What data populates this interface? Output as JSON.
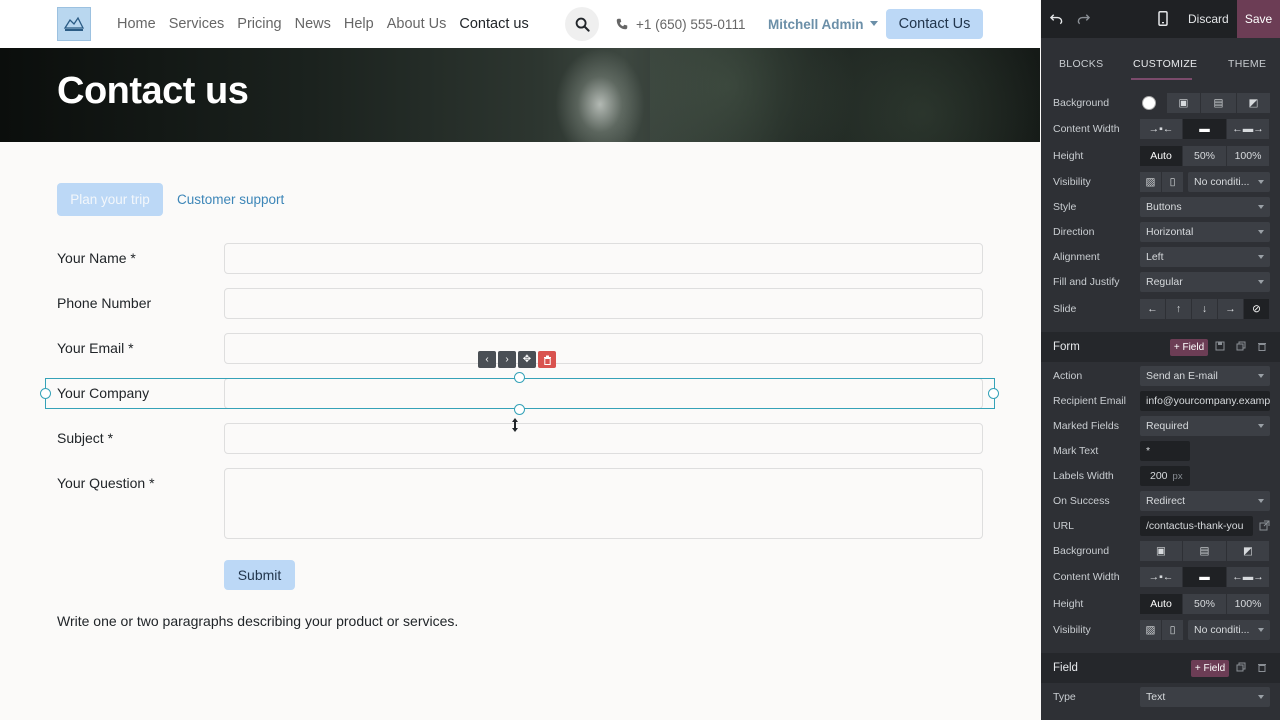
{
  "navbar": {
    "links": [
      "Home",
      "Services",
      "Pricing",
      "News",
      "Help",
      "About Us",
      "Contact us"
    ],
    "active_index": 6,
    "phone": "+1 (650) 555-0111",
    "user": "Mitchell Admin",
    "cta": "Contact Us"
  },
  "hero": {
    "title": "Contact us"
  },
  "tabs": {
    "active": "Plan your trip",
    "other": "Customer support"
  },
  "form": {
    "fields": [
      {
        "label": "Your Name",
        "required": true
      },
      {
        "label": "Phone Number",
        "required": false
      },
      {
        "label": "Your Email",
        "required": true
      },
      {
        "label": "Your Company",
        "required": false
      },
      {
        "label": "Subject",
        "required": true
      },
      {
        "label": "Your Question",
        "required": true
      }
    ],
    "mark": "*",
    "submit": "Submit",
    "paragraph": "Write one or two paragraphs describing your product or services."
  },
  "editor": {
    "discard": "Discard",
    "save": "Save",
    "tabs": [
      "BLOCKS",
      "CUSTOMIZE",
      "THEME"
    ],
    "active_tab": "CUSTOMIZE",
    "section1": {
      "background": "Background",
      "content_width": "Content Width",
      "height": "Height",
      "height_opts": [
        "Auto",
        "50%",
        "100%"
      ],
      "visibility": "Visibility",
      "visibility_val": "No conditi...",
      "style": "Style",
      "style_val": "Buttons",
      "direction": "Direction",
      "direction_val": "Horizontal",
      "alignment": "Alignment",
      "alignment_val": "Left",
      "fill": "Fill and Justify",
      "fill_val": "Regular",
      "slide": "Slide",
      "slide_opts": [
        "←",
        "↑",
        "↓",
        "→",
        "⊘"
      ]
    },
    "form_section": {
      "title": "Form",
      "add_field": "+ Field",
      "action": "Action",
      "action_val": "Send an E-mail",
      "recipient": "Recipient Email",
      "recipient_val": "info@yourcompany.example.com",
      "marked": "Marked Fields",
      "marked_val": "Required",
      "mark_text": "Mark Text",
      "mark_text_val": "*",
      "labels_width": "Labels Width",
      "labels_width_val": "200",
      "labels_width_unit": "px",
      "on_success": "On Success",
      "on_success_val": "Redirect",
      "url": "URL",
      "url_val": "/contactus-thank-you",
      "background": "Background",
      "content_width": "Content Width",
      "height": "Height",
      "height_opts": [
        "Auto",
        "50%",
        "100%"
      ],
      "visibility": "Visibility",
      "visibility_val": "No conditi..."
    },
    "field_section": {
      "title": "Field",
      "add_field": "+ Field",
      "type": "Type",
      "type_val": "Text"
    }
  }
}
